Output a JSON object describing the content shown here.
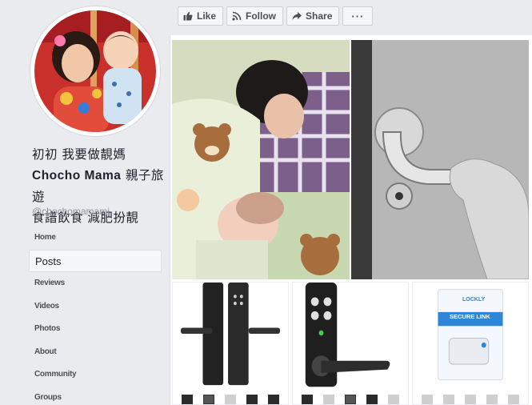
{
  "sidebar": {
    "page_name_line1": "初初  我要做靚媽",
    "page_name_line2a": "Chocho  Mama",
    "page_name_line2b": " 親子旅遊",
    "page_name_line3": "食譜飲食  減肥扮靚",
    "handle": "@chochomamami",
    "nav": [
      {
        "label": "Home"
      },
      {
        "label": "Posts",
        "active": true
      },
      {
        "label": "Reviews"
      },
      {
        "label": "Videos"
      },
      {
        "label": "Photos"
      },
      {
        "label": "About"
      },
      {
        "label": "Community"
      },
      {
        "label": "Groups"
      }
    ]
  },
  "actions": {
    "like": "Like",
    "follow": "Follow",
    "share": "Share",
    "more": "···"
  },
  "photos": {
    "product_box_brand": "LOCKLY",
    "product_box_title": "SECURE LINK"
  },
  "colors": {
    "background": "#e9ebee",
    "panel": "#ffffff",
    "button_border": "#ced0d4",
    "muted_text": "#90949c"
  }
}
